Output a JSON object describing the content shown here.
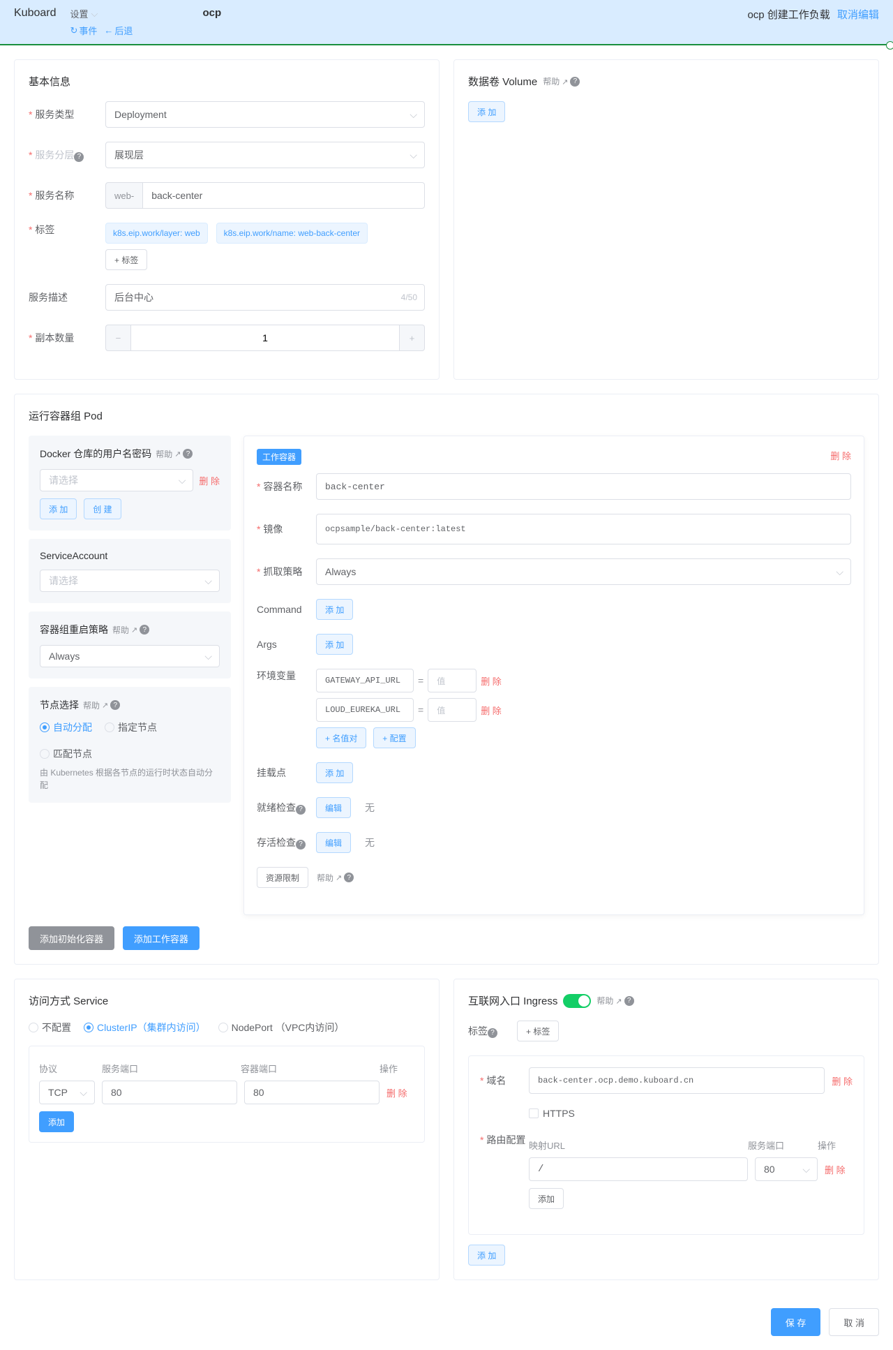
{
  "header": {
    "brand": "Kuboard",
    "settings": "设置",
    "events": "事件",
    "back": "后退",
    "namespace": "ocp",
    "pageTitle1": "ocp",
    "pageTitle2": "创建工作负载",
    "cancelEdit": "取消编辑"
  },
  "basic": {
    "title": "基本信息",
    "serviceTypeLabel": "服务类型",
    "serviceType": "Deployment",
    "layerLabel": "服务分层",
    "layer": "展现层",
    "nameLabel": "服务名称",
    "prefix": "web-",
    "name": "back-center",
    "tagsLabel": "标签",
    "tag1": "k8s.eip.work/layer: web",
    "tag2": "k8s.eip.work/name: web-back-center",
    "addTag": "+ 标签",
    "descLabel": "服务描述",
    "desc": "后台中心",
    "descCount": "4/50",
    "replicasLabel": "副本数量",
    "replicas": "1"
  },
  "volume": {
    "title": "数据卷 Volume",
    "help": "帮助",
    "add": "添 加"
  },
  "pod": {
    "title": "运行容器组 Pod",
    "docker": {
      "title": "Docker 仓库的用户名密码",
      "help": "帮助",
      "placeholder": "请选择",
      "delete": "删 除",
      "add": "添 加",
      "create": "创 建"
    },
    "sa": {
      "title": "ServiceAccount",
      "placeholder": "请选择"
    },
    "restart": {
      "title": "容器组重启策略",
      "help": "帮助",
      "value": "Always"
    },
    "node": {
      "title": "节点选择",
      "help": "帮助",
      "auto": "自动分配",
      "assign": "指定节点",
      "match": "匹配节点",
      "hint": "由 Kubernetes 根据各节点的运行时状态自动分配"
    },
    "container": {
      "badge": "工作容器",
      "delete": "删 除",
      "nameLabel": "容器名称",
      "name": "back-center",
      "imageLabel": "镜像",
      "image": "ocpsample/back-center:latest",
      "pullLabel": "抓取策略",
      "pull": "Always",
      "commandLabel": "Command",
      "argsLabel": "Args",
      "add": "添 加",
      "envLabel": "环境变量",
      "env1Name": "GATEWAY_API_URL",
      "env1Val": "值",
      "env2Name": "LOUD_EUREKA_URL",
      "env2Val": "值",
      "addPair": "+ 名值对",
      "addConfig": "+ 配置",
      "mountLabel": "挂载点",
      "readyLabel": "就绪检查",
      "liveLabel": "存活检查",
      "edit": "编辑",
      "none": "无",
      "resource": "资源限制",
      "help": "帮助"
    },
    "addInit": "添加初始化容器",
    "addWork": "添加工作容器"
  },
  "service": {
    "title": "访问方式 Service",
    "none": "不配置",
    "clusterip": "ClusterIP（集群内访问）",
    "nodeport": "NodePort （VPC内访问）",
    "protocol": "协议",
    "svcPort": "服务端口",
    "containerPort": "容器端口",
    "action": "操作",
    "tcp": "TCP",
    "p80": "80",
    "delete": "删 除",
    "add": "添加"
  },
  "ingress": {
    "title": "互联网入口 Ingress",
    "help": "帮助",
    "tagsLabel": "标签",
    "addTag": "+ 标签",
    "domainLabel": "域名",
    "domain": "back-center.ocp.demo.kuboard.cn",
    "delete": "删 除",
    "https": "HTTPS",
    "routeLabel": "路由配置",
    "mapUrl": "映射URL",
    "svcPort": "服务端口",
    "action": "操作",
    "path": "/",
    "port": "80",
    "add": "添加",
    "addOuter": "添 加"
  },
  "footer": {
    "save": "保 存",
    "cancel": "取 消"
  }
}
